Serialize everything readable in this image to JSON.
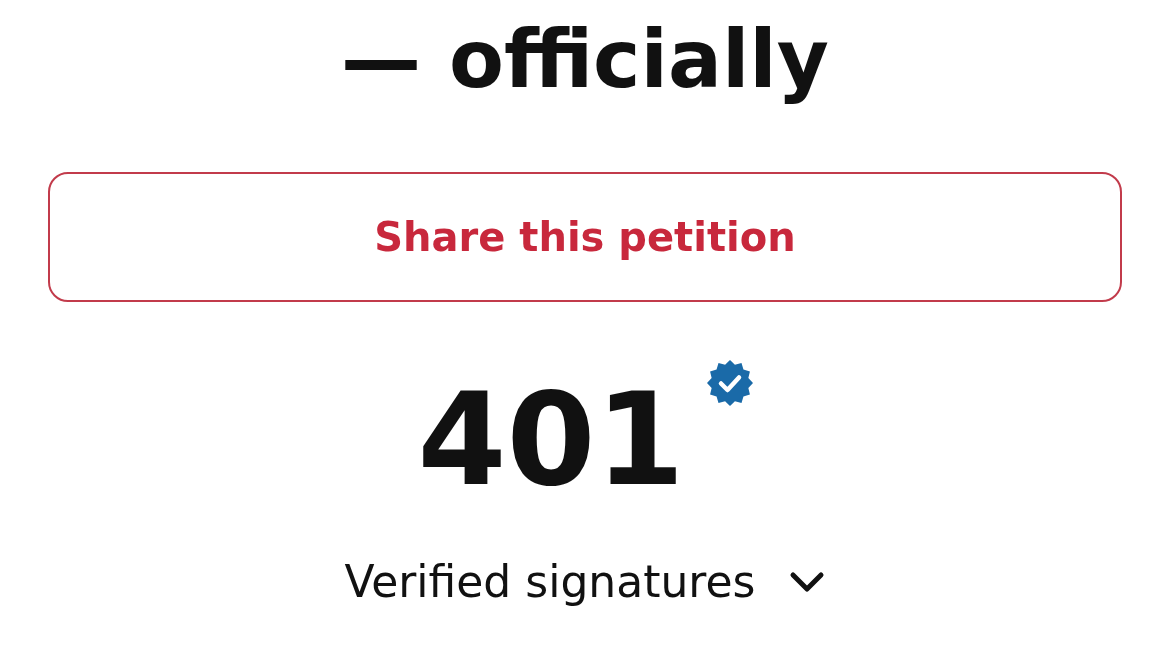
{
  "heading": "— officially",
  "share_button": {
    "label": "Share this petition"
  },
  "signatures": {
    "count": "401",
    "verified": true,
    "label": "Verified signatures",
    "expanded": false
  }
}
